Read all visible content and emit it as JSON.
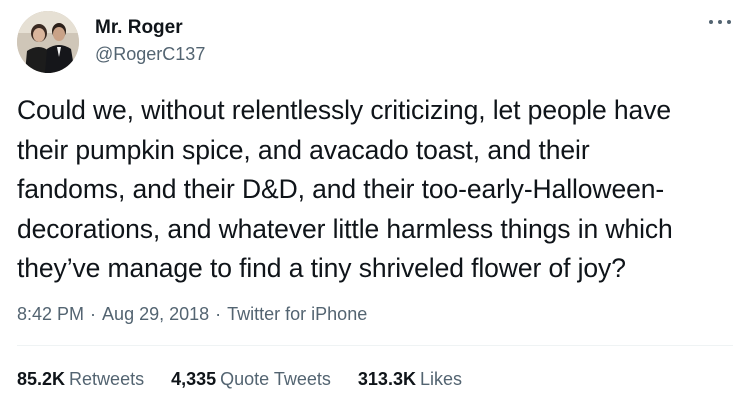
{
  "author": {
    "display_name": "Mr. Roger",
    "handle": "@RogerC137"
  },
  "tweet": {
    "lines": [
      "Could we, without relentlessly criticizing, let people have",
      "their pumpkin spice, and avacado toast, and their",
      "fandoms, and their D&D, and their too-early-Halloween-",
      "decorations, and whatever little harmless things in which",
      "they’ve manage to find a tiny shriveled flower of joy?"
    ]
  },
  "meta": {
    "time": "8:42 PM",
    "separator": "·",
    "date": "Aug 29, 2018",
    "source": "Twitter for iPhone"
  },
  "stats": [
    {
      "value": "85.2K",
      "label": "Retweets"
    },
    {
      "value": "4,335",
      "label": "Quote Tweets"
    },
    {
      "value": "313.3K",
      "label": "Likes"
    }
  ],
  "icons": {
    "more": "more-horizontal-icon"
  },
  "colors": {
    "text_primary": "#0f1419",
    "text_secondary": "#536471",
    "divider": "#eff3f4"
  }
}
